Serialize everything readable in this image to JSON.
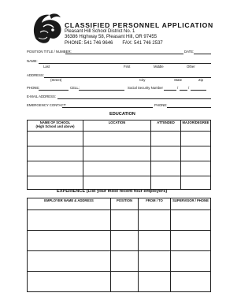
{
  "header": {
    "title": "CLASSIFIED PERSONNEL APPLICATION",
    "district": "Pleasant Hill School District No. 1",
    "address": "36386 Highway 58, Pleasant Hill, OR  97455",
    "phone": "PHONE:  541 746 9646",
    "fax": "FAX:  541 746 2537"
  },
  "form": {
    "position_label": "POSITION TITLE / NUMBER:",
    "date_label": "DATE:",
    "name_label": "NAME:",
    "name_sub": [
      "Last",
      "First",
      "Middle",
      "Other"
    ],
    "address_label": "ADDRESS:",
    "address_sub": [
      "(Street)",
      "City",
      "State",
      "Zip"
    ],
    "phone_label": "PHONE:",
    "cell_label": "CELL:",
    "ssn_label": "Social Security Number",
    "email_label": "E-MAIL ADDRESS:",
    "emergency_label": "EMERGENCY CONTACT:",
    "emergency_phone_label": "PHONE:"
  },
  "education": {
    "heading": "EDUCATION",
    "columns": [
      "NAME OF SCHOOL\n(High School and above)",
      "LOCATION",
      "ATTENDED",
      "MAJOR/DEGREE"
    ]
  },
  "experience": {
    "heading": "EXPERIENCE (List your most recent four employers)",
    "columns": [
      "EMPLOYER NAME & ADDRESS",
      "POSITION",
      "FROM / TO",
      "SUPERVISOR / PHONE"
    ]
  }
}
